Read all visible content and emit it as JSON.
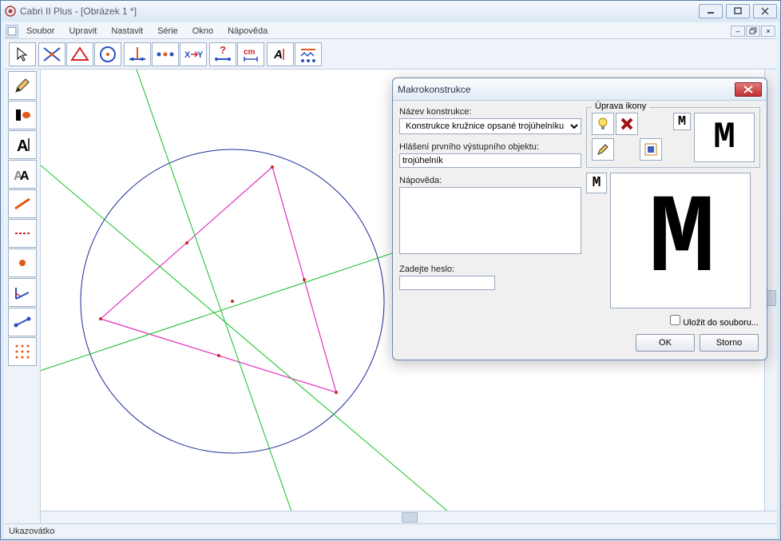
{
  "window": {
    "title": "Cabri II Plus - [Obrázek 1 *]"
  },
  "menu": {
    "file": "Soubor",
    "edit": "Upravit",
    "settings": "Nastavit",
    "series": "Série",
    "window": "Okno",
    "help": "Nápověda"
  },
  "statusbar": {
    "text": "Ukazovátko"
  },
  "dialog": {
    "title": "Makrokonstrukce",
    "name_label": "Název konstrukce:",
    "name_value": "Konstrukce kružnice opsané trojúhelníku",
    "output_label": "Hlášení prvního výstupního objektu:",
    "output_value": "trojúhelník",
    "help_label": "Nápověda:",
    "help_value": "",
    "password_label": "Zadejte heslo:",
    "password_value": "",
    "icon_legend": "Úprava ikony",
    "save_checkbox": "Uložit do souboru...",
    "ok": "OK",
    "cancel": "Storno"
  },
  "icons": {
    "pointer": "pointer",
    "lines": "lines",
    "triangle": "triangle",
    "circle": "circle",
    "perpendicular": "perpendicular",
    "midpoint": "midpoint",
    "transform": "transform",
    "macro": "macro",
    "measure": "measure",
    "label": "label",
    "appearance": "appearance"
  }
}
